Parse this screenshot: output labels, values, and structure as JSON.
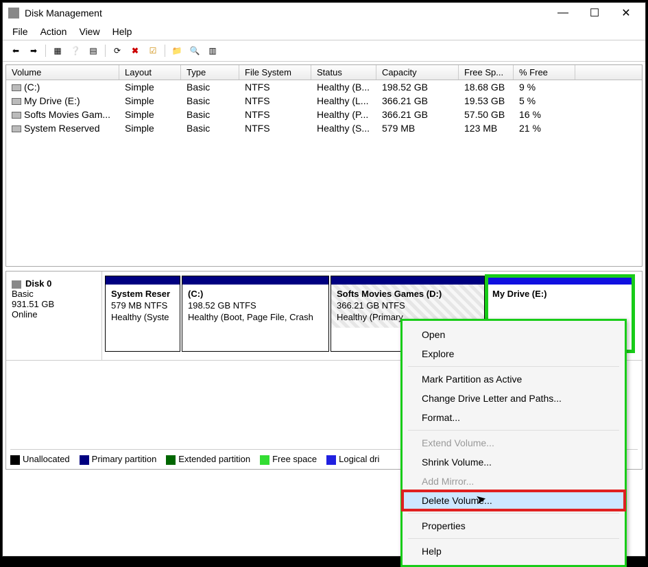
{
  "window": {
    "title": "Disk Management"
  },
  "menu": {
    "file": "File",
    "action": "Action",
    "view": "View",
    "help": "Help"
  },
  "columns": {
    "volume": "Volume",
    "layout": "Layout",
    "type": "Type",
    "fs": "File System",
    "status": "Status",
    "capacity": "Capacity",
    "free": "Free Sp...",
    "pct": "% Free"
  },
  "volumes": [
    {
      "name": "(C:)",
      "layout": "Simple",
      "type": "Basic",
      "fs": "NTFS",
      "status": "Healthy (B...",
      "capacity": "198.52 GB",
      "free": "18.68 GB",
      "pct": "9 %"
    },
    {
      "name": "My Drive (E:)",
      "layout": "Simple",
      "type": "Basic",
      "fs": "NTFS",
      "status": "Healthy (L...",
      "capacity": "366.21 GB",
      "free": "19.53 GB",
      "pct": "5 %"
    },
    {
      "name": "Softs Movies Gam...",
      "layout": "Simple",
      "type": "Basic",
      "fs": "NTFS",
      "status": "Healthy (P...",
      "capacity": "366.21 GB",
      "free": "57.50 GB",
      "pct": "16 %"
    },
    {
      "name": "System Reserved",
      "layout": "Simple",
      "type": "Basic",
      "fs": "NTFS",
      "status": "Healthy (S...",
      "capacity": "579 MB",
      "free": "123 MB",
      "pct": "21 %"
    }
  ],
  "disk": {
    "name": "Disk 0",
    "type": "Basic",
    "size": "931.51 GB",
    "status": "Online"
  },
  "parts": [
    {
      "name": "System Reser",
      "line2": "579 MB NTFS",
      "line3": "Healthy (Syste"
    },
    {
      "name": "(C:)",
      "line2": "198.52 GB NTFS",
      "line3": "Healthy (Boot, Page File, Crash"
    },
    {
      "name": "Softs Movies Games  (D:)",
      "line2": "366.21 GB NTFS",
      "line3": "Healthy (Primary"
    },
    {
      "name": "My Drive  (E:)",
      "line2": "",
      "line3": ""
    }
  ],
  "legend": {
    "unalloc": "Unallocated",
    "primary": "Primary partition",
    "extended": "Extended partition",
    "free": "Free space",
    "logical": "Logical dri"
  },
  "ctx": {
    "open": "Open",
    "explore": "Explore",
    "mark": "Mark Partition as Active",
    "change": "Change Drive Letter and Paths...",
    "format": "Format...",
    "extend": "Extend Volume...",
    "shrink": "Shrink Volume...",
    "mirror": "Add Mirror...",
    "delete": "Delete Volume...",
    "props": "Properties",
    "help": "Help"
  }
}
